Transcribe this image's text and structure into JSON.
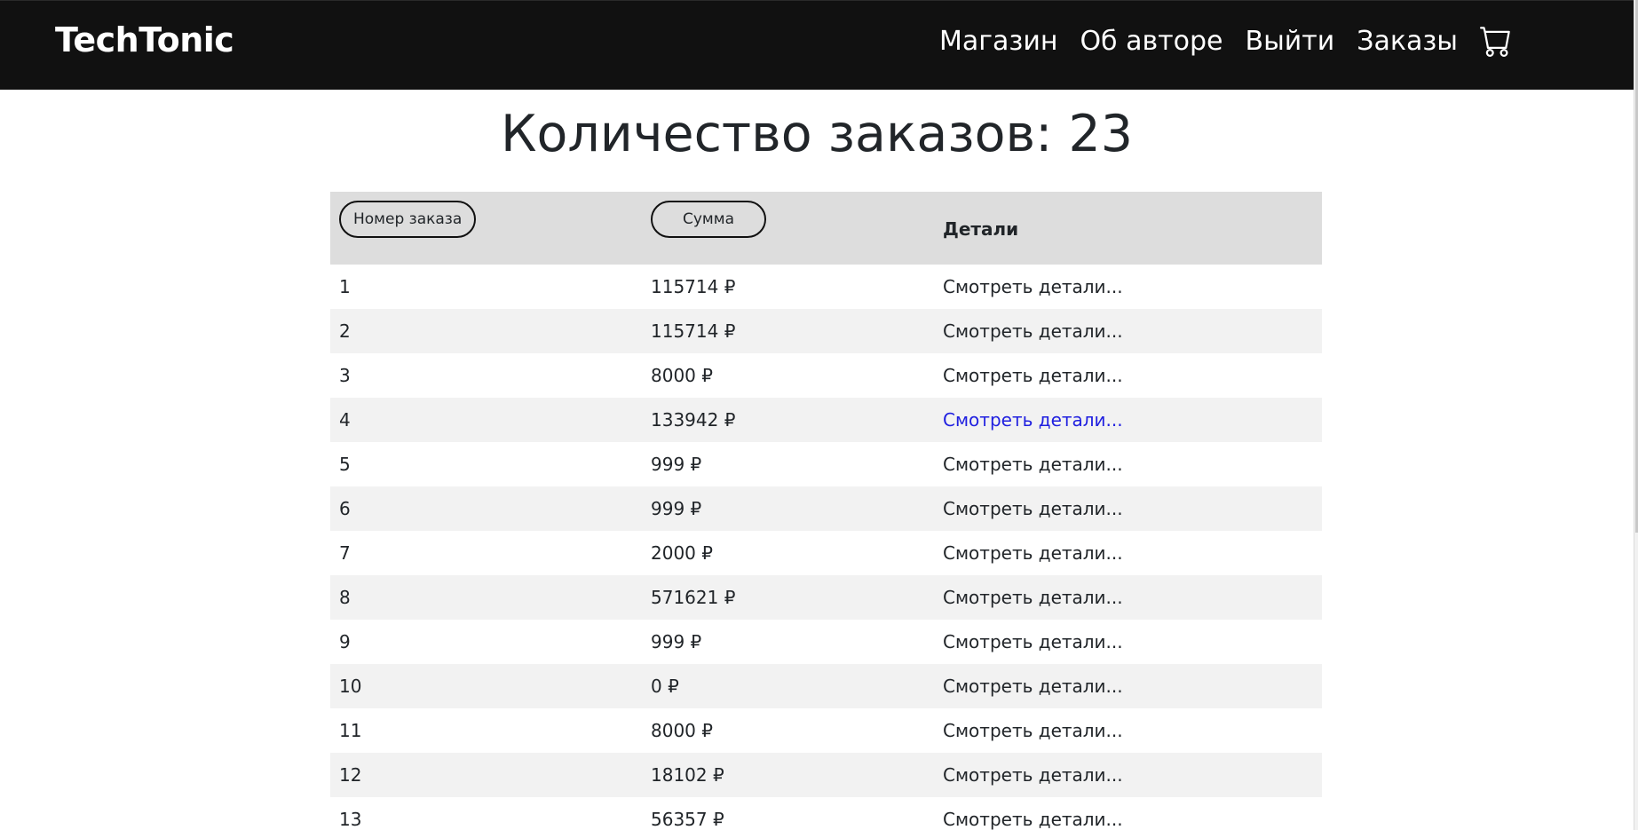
{
  "navbar": {
    "brand": "TechTonic",
    "links": [
      {
        "label": "Магазин"
      },
      {
        "label": "Об авторе"
      },
      {
        "label": "Выйти"
      },
      {
        "label": "Заказы"
      }
    ],
    "cart_icon": "cart-icon"
  },
  "page": {
    "title_prefix": "Количество заказов:",
    "order_count": "23"
  },
  "table": {
    "headers": {
      "order_number": "Номер заказа",
      "sum": "Сумма",
      "details": "Детали"
    },
    "rows": [
      {
        "number": "1",
        "sum": "115714 ₽",
        "details": "Смотреть детали..."
      },
      {
        "number": "2",
        "sum": "115714 ₽",
        "details": "Смотреть детали..."
      },
      {
        "number": "3",
        "sum": "8000 ₽",
        "details": "Смотреть детали..."
      },
      {
        "number": "4",
        "sum": "133942 ₽",
        "details": "Смотреть детали..."
      },
      {
        "number": "5",
        "sum": "999 ₽",
        "details": "Смотреть детали..."
      },
      {
        "number": "6",
        "sum": "999 ₽",
        "details": "Смотреть детали..."
      },
      {
        "number": "7",
        "sum": "2000 ₽",
        "details": "Смотреть детали..."
      },
      {
        "number": "8",
        "sum": "571621 ₽",
        "details": "Смотреть детали..."
      },
      {
        "number": "9",
        "sum": "999 ₽",
        "details": "Смотреть детали..."
      },
      {
        "number": "10",
        "sum": "0 ₽",
        "details": "Смотреть детали..."
      },
      {
        "number": "11",
        "sum": "8000 ₽",
        "details": "Смотреть детали..."
      },
      {
        "number": "12",
        "sum": "18102 ₽",
        "details": "Смотреть детали..."
      },
      {
        "number": "13",
        "sum": "56357 ₽",
        "details": "Смотреть детали..."
      }
    ],
    "hovered_row_index": 3
  },
  "colors": {
    "navbar_bg": "#111111",
    "link_hover": "#2020e0",
    "header_bg": "#dddddd",
    "stripe_bg": "#f2f2f2"
  }
}
